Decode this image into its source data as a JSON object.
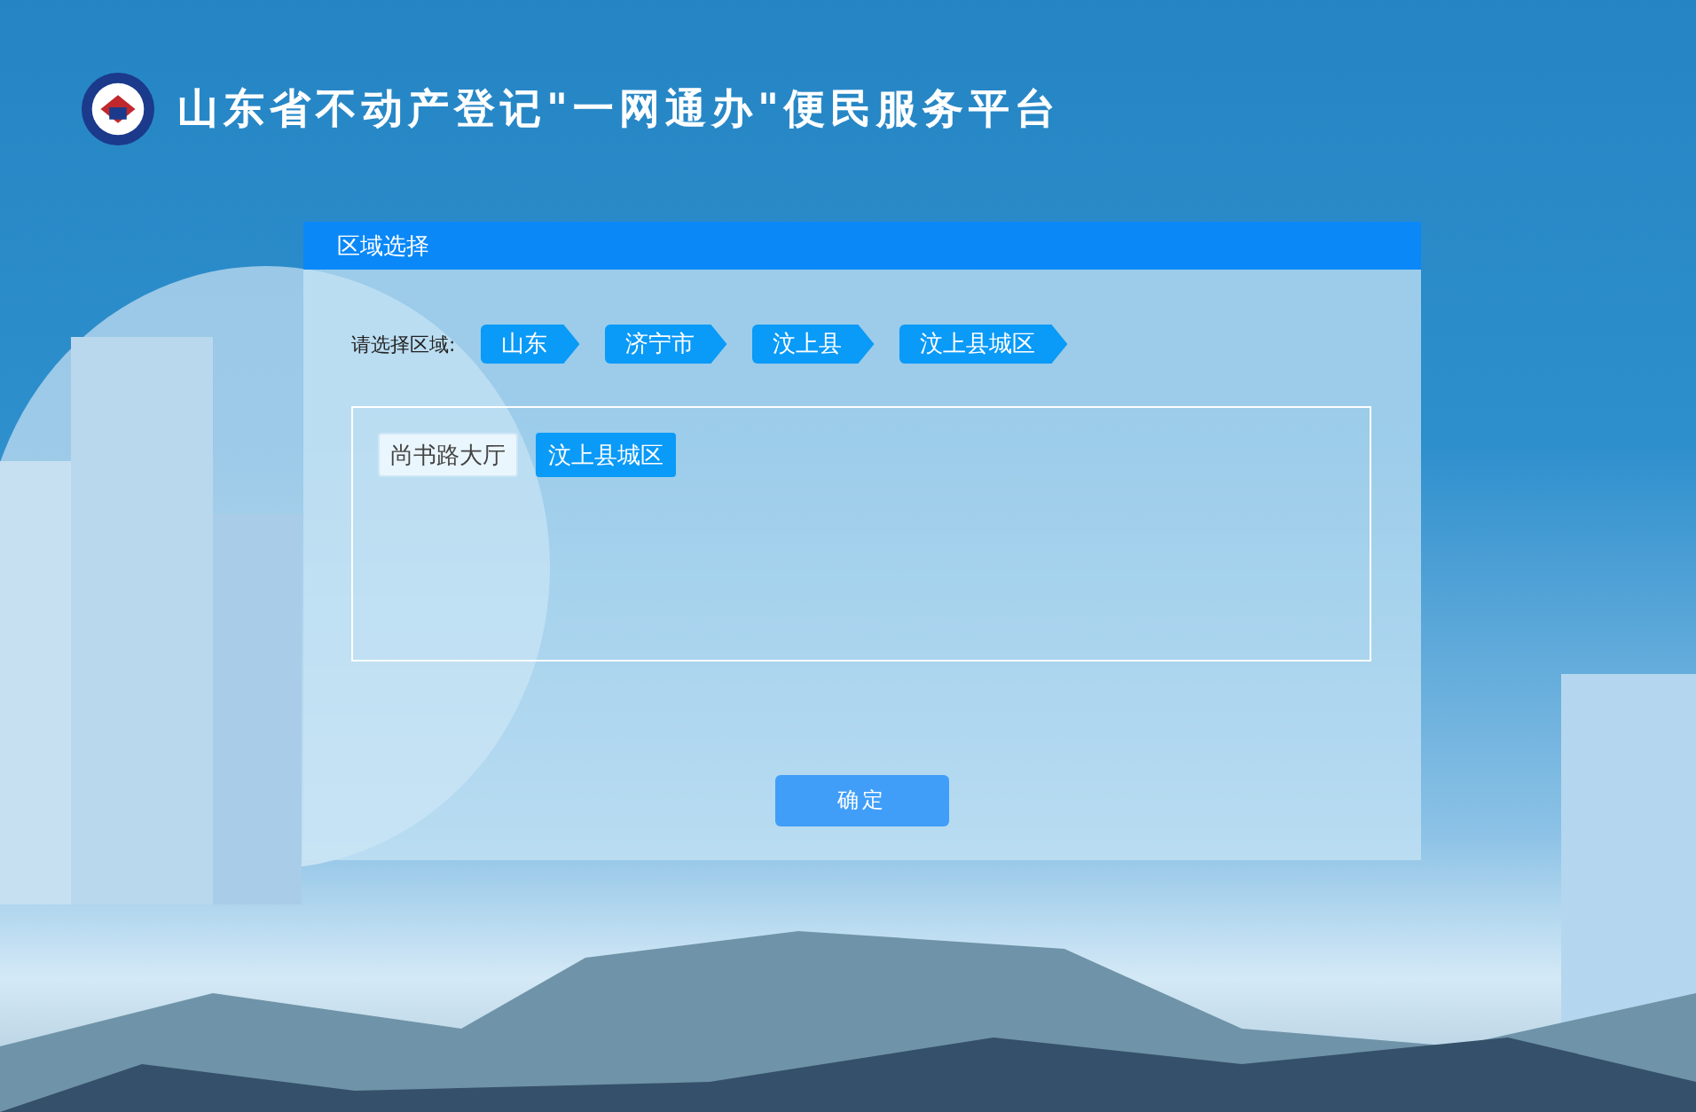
{
  "header": {
    "title": "山东省不动产登记\"一网通办\"便民服务平台"
  },
  "panel": {
    "title": "区域选择",
    "region_label": "请选择区域:",
    "breadcrumbs": [
      {
        "label": "山东"
      },
      {
        "label": "济宁市"
      },
      {
        "label": "汶上县"
      },
      {
        "label": "汶上县城区"
      }
    ],
    "options": [
      {
        "label": "尚书路大厅",
        "selected": false
      },
      {
        "label": "汶上县城区",
        "selected": true
      }
    ],
    "confirm_button": "确定"
  }
}
